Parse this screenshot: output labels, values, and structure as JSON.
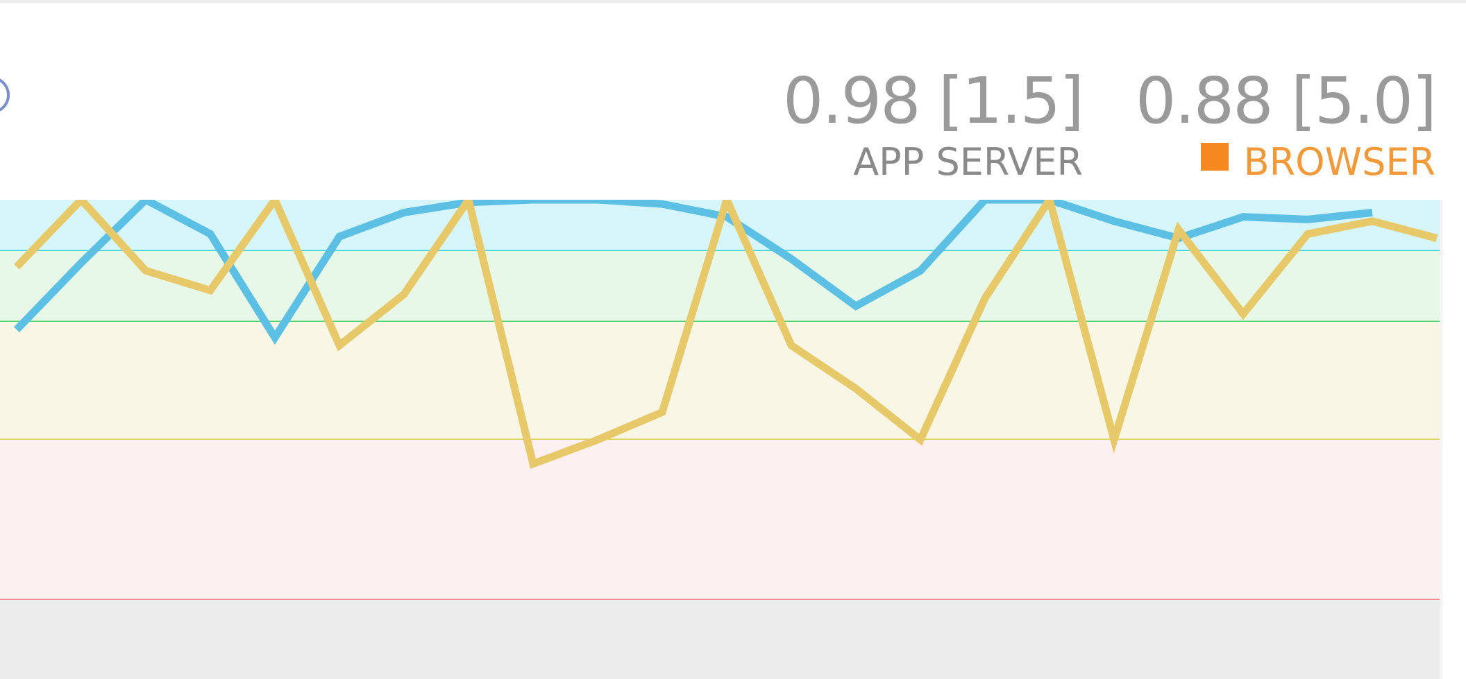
{
  "metrics": {
    "app_server": {
      "value": "0.98 [1.5]",
      "label": "APP SERVER"
    },
    "browser": {
      "value": "0.88 [5.0]",
      "label": "BROWSER"
    }
  },
  "chart_data": {
    "type": "line",
    "ylim": [
      0,
      1
    ],
    "thresholds": [
      {
        "name": "excellent",
        "from": 0.94,
        "to": 1.0,
        "band_color": "#d6f6fb",
        "line_color": "#2fd4de"
      },
      {
        "name": "good",
        "from": 0.85,
        "to": 0.94,
        "band_color": "#e8f8e8",
        "line_color": "#4cd46a"
      },
      {
        "name": "fair",
        "from": 0.7,
        "to": 0.85,
        "band_color": "#f8f6e4",
        "line_color": "#d9cf4a"
      },
      {
        "name": "poor",
        "from": 0.5,
        "to": 0.7,
        "band_color": "#fdf0f0",
        "line_color": "#ee8d8d"
      },
      {
        "name": "unacceptable",
        "from": 0.0,
        "to": 0.5,
        "band_color": "#ececec",
        "line_color": "#e8e8e8"
      }
    ],
    "series": [
      {
        "name": "APP SERVER",
        "color": "#5bc0e3",
        "points": [
          [
            0,
            0.84
          ],
          [
            1,
            0.925
          ],
          [
            2,
            1.0
          ],
          [
            3,
            0.96
          ],
          [
            4,
            0.83
          ],
          [
            5,
            0.957
          ],
          [
            6,
            0.985
          ],
          [
            7,
            0.997
          ],
          [
            8,
            1.0
          ],
          [
            9,
            1.0
          ],
          [
            10,
            0.995
          ],
          [
            11,
            0.98
          ],
          [
            12,
            0.93
          ],
          [
            13,
            0.87
          ],
          [
            14,
            0.915
          ],
          [
            15,
            1.0
          ],
          [
            16,
            1.0
          ],
          [
            17,
            0.975
          ],
          [
            18,
            0.955
          ],
          [
            19,
            0.98
          ],
          [
            20,
            0.977
          ],
          [
            21,
            0.985
          ]
        ]
      },
      {
        "name": "BROWSER",
        "color": "#e8c96a",
        "points": [
          [
            0,
            0.92
          ],
          [
            1,
            1.0
          ],
          [
            2,
            0.915
          ],
          [
            3,
            0.89
          ],
          [
            4,
            1.0
          ],
          [
            5,
            0.82
          ],
          [
            6,
            0.885
          ],
          [
            7,
            1.0
          ],
          [
            8,
            0.67
          ],
          [
            9,
            0.7
          ],
          [
            10,
            0.735
          ],
          [
            11,
            1.0
          ],
          [
            12,
            0.82
          ],
          [
            13,
            0.765
          ],
          [
            14,
            0.7
          ],
          [
            15,
            0.88
          ],
          [
            16,
            1.0
          ],
          [
            17,
            0.7
          ],
          [
            18,
            0.965
          ],
          [
            19,
            0.86
          ],
          [
            20,
            0.96
          ],
          [
            21,
            0.975
          ],
          [
            22,
            0.955
          ]
        ]
      }
    ]
  }
}
